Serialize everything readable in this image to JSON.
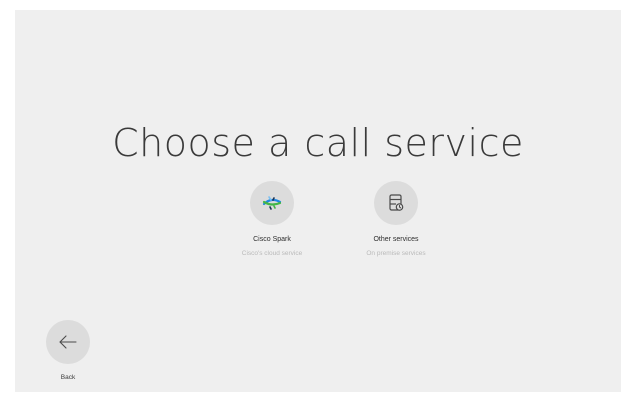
{
  "page": {
    "title": "Choose a call service"
  },
  "options": [
    {
      "label": "Cisco Spark",
      "subtitle": "Cisco's cloud service",
      "icon": "cisco-spark-icon"
    },
    {
      "label": "Other services",
      "subtitle": "On premise services",
      "icon": "server-icon"
    }
  ],
  "back": {
    "label": "Back",
    "icon": "arrow-left-icon"
  },
  "colors": {
    "background": "#efefef",
    "circle": "#dcdcdc",
    "title": "#3a3a3a",
    "subtitle": "#b9b9b9"
  }
}
